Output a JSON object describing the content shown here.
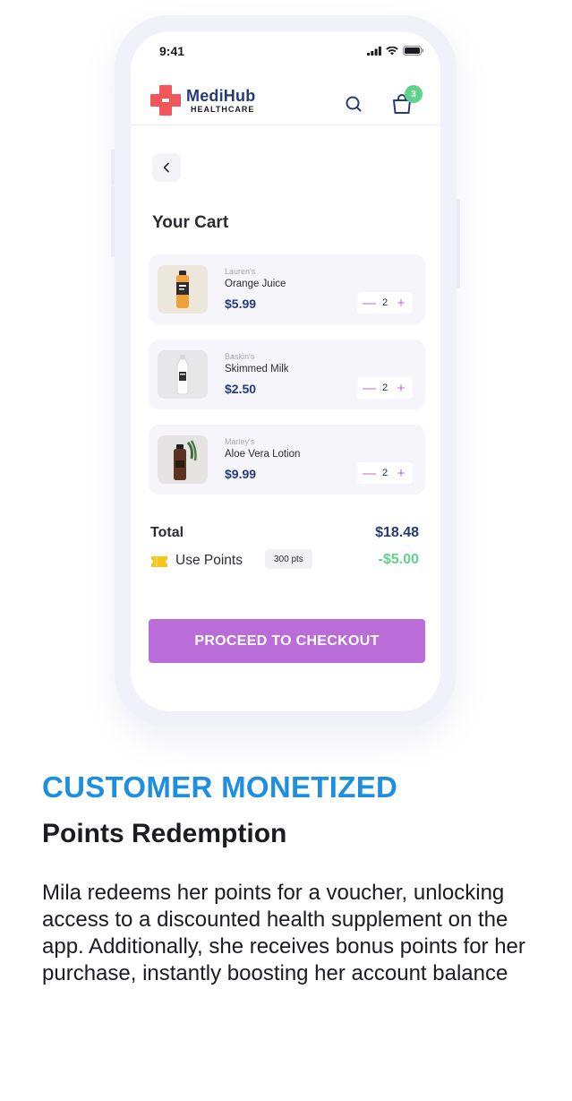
{
  "status_bar": {
    "time": "9:41"
  },
  "app": {
    "brand_name": "MediHub",
    "brand_sub": "HEALTHCARE",
    "cart_count": "3"
  },
  "page_title": "Your Cart",
  "cart_items": [
    {
      "brand": "Lauren's",
      "name": "Orange Juice",
      "price": "$5.99",
      "qty": "2"
    },
    {
      "brand": "Baskin's",
      "name": "Skimmed Milk",
      "price": "$2.50",
      "qty": "2"
    },
    {
      "brand": "Marley's",
      "name": "Aloe Vera Lotion",
      "price": "$9.99",
      "qty": "2"
    }
  ],
  "summary": {
    "total_label": "Total",
    "total_value": "$18.48",
    "points_label": "Use Points",
    "points_badge": "300 pts",
    "discount_value": "-$5.00"
  },
  "checkout_label": "PROCEED TO CHECKOUT",
  "caption": {
    "kicker": "CUSTOMER MONETIZED",
    "headline": "Points Redemption",
    "description": "Mila redeems her points for a voucher, unlocking access to a discounted health supplement on the app. Additionally, she receives bonus points for her purchase, instantly boosting her account balance"
  },
  "colors": {
    "accent_purple": "#ba6cd8",
    "brand_navy": "#243a7a",
    "positive_green": "#5fd38a",
    "kicker_blue": "#1e8fe0",
    "logo_red": "#f2555a"
  },
  "icons": [
    "signal-icon",
    "wifi-icon",
    "battery-icon",
    "medihub-logo-icon",
    "search-icon",
    "shopping-bag-icon",
    "chevron-left-icon",
    "ticket-icon",
    "minus-icon",
    "plus-icon"
  ]
}
